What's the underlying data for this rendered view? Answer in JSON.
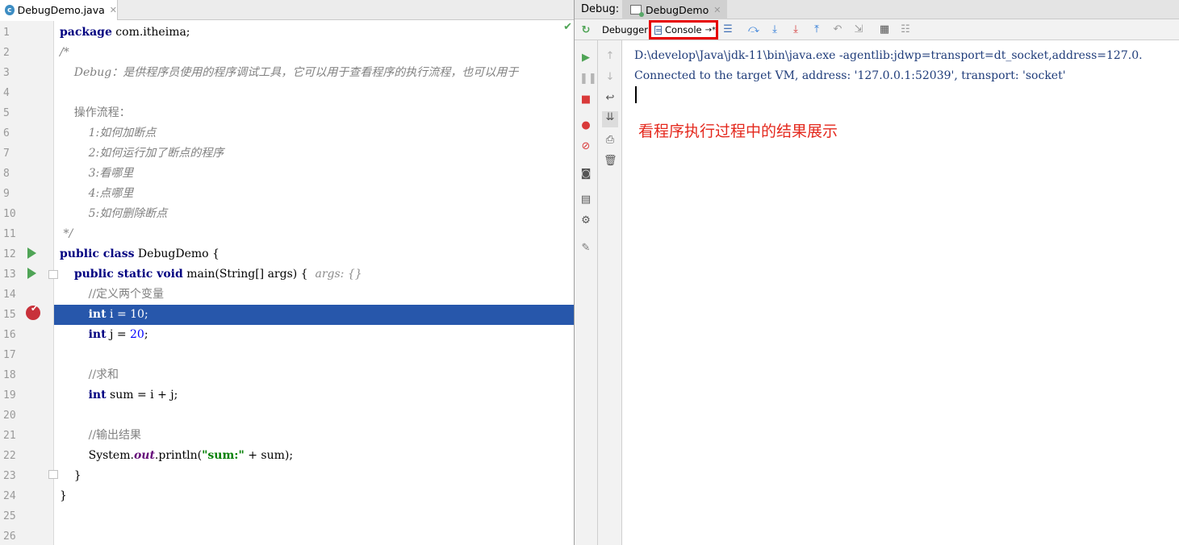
{
  "editor": {
    "tab_label": "DebugDemo.java",
    "tab_icon": "java-class-icon",
    "line_numbers": [
      "1",
      "2",
      "3",
      "4",
      "5",
      "6",
      "7",
      "8",
      "9",
      "10",
      "11",
      "12",
      "13",
      "14",
      "15",
      "16",
      "17",
      "18",
      "19",
      "20",
      "21",
      "22",
      "23",
      "24",
      "25",
      "26"
    ],
    "code": {
      "l1_kw": "package",
      "l1_rest": " com.itheima;",
      "l2": "/*",
      "l3": "    Debug：是供程序员使用的程序调试工具，它可以用于查看程序的执行流程，也可以用于",
      "l5": "    操作流程：",
      "l6": "        1:如何加断点",
      "l7": "        2:如何运行加了断点的程序",
      "l8": "        3:看哪里",
      "l9": "        4:点哪里",
      "l10": "        5:如何删除断点",
      "l11": " */",
      "l12_kw": "public class",
      "l12_rest": " DebugDemo {",
      "l13_indent": "    ",
      "l13_kw": "public static void",
      "l13_rest": " main(String[] args) {  ",
      "l13_hint": "args: {}",
      "l14": "        //定义两个变量",
      "l15_indent": "        ",
      "l15_kw": "int",
      "l15_mid": " i = ",
      "l15_num": "10",
      "l15_end": ";",
      "l16_indent": "        ",
      "l16_kw": "int",
      "l16_mid": " j = ",
      "l16_num": "20",
      "l16_end": ";",
      "l18": "        //求和",
      "l19_indent": "        ",
      "l19_kw": "int",
      "l19_rest": " sum = i + j;",
      "l21": "        //输出结果",
      "l22_a": "        System.",
      "l22_out": "out",
      "l22_b": ".println(",
      "l22_str": "\"sum:\"",
      "l22_c": " + sum);",
      "l23": "    }",
      "l24": "}"
    }
  },
  "debug": {
    "title": "Debug:",
    "session_tab": "DebugDemo",
    "debugger_tab": "Debugger",
    "console_tab": "Console",
    "console_tab_suffix": "→*",
    "output_lines": [
      "D:\\develop\\Java\\jdk-11\\bin\\java.exe -agentlib:jdwp=transport=dt_socket,address=127.0.",
      "Connected to the target VM, address: '127.0.0.1:52039', transport: 'socket'"
    ],
    "annotation": "看程序执行过程中的结果展示"
  },
  "colors": {
    "highlight": "#2757ab",
    "keyword": "#000080",
    "annotation_red": "#e4281d",
    "console_box": "#e60000",
    "run_green": "#4fa456",
    "breakpoint_red": "#c8313a"
  }
}
